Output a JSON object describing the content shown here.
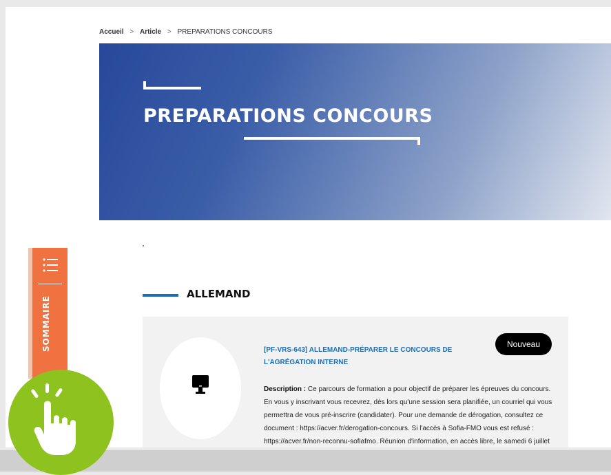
{
  "breadcrumb": {
    "home": "Accueil",
    "article": "Article",
    "current": "PREPARATIONS CONCOURS",
    "separator": ">"
  },
  "hero": {
    "title": "PREPARATIONS CONCOURS",
    "gradient_start": "#27489a",
    "gradient_end": "#e1e6ef"
  },
  "sidebar": {
    "label": "SOMMAIRE",
    "icon": "list-icon",
    "color": "#f07240"
  },
  "section": {
    "title": "ALLEMAND",
    "accent_color": "#1c6bb5"
  },
  "course": {
    "badge": "Nouveau",
    "title": "[PF-VRS-643] ALLEMAND-PRÉPARER LE CONCOURS DE L'AGRÉGATION INTERNE",
    "description_label": "Description :",
    "description_text": "Ce parcours de formation a pour objectif de préparer les épreuves du concours. En vous y inscrivant vous recevrez, dès lors qu'une session sera planifiée, un courriel qui vous permettra de vous pré-inscrire (candidater). Pour une demande de dérogation, consultez ce document : https://acver.fr/derogation-concours. Si l'accès à Sofia-FMO vous est refusé : https://acver.fr/non-reconnu-sofiafmo. Réunion d'information, en accès libre, le samedi 6 juillet",
    "icon": "computer-icon",
    "title_color": "#1a6fb8"
  },
  "accessibility_button": {
    "icon": "hand-pointer-icon",
    "color": "#8dc21f"
  }
}
